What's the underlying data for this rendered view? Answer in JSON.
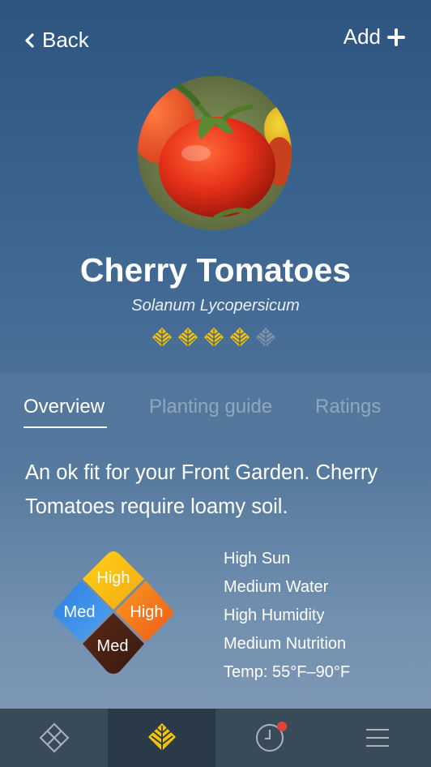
{
  "header": {
    "back_label": "Back",
    "add_label": "Add"
  },
  "plant": {
    "name": "Cherry Tomatoes",
    "scientific_name": "Solanum Lycopersicum",
    "rating": {
      "filled": 4,
      "total": 5
    }
  },
  "tabs": [
    {
      "label": "Overview",
      "active": true
    },
    {
      "label": "Planting guide",
      "active": false
    },
    {
      "label": "Ratings",
      "active": false
    }
  ],
  "overview": {
    "description": "An ok fit for your Front Garden. Cherry Tomatoes require loamy soil.",
    "diamond": {
      "top": "High",
      "left": "Med",
      "right": "High",
      "bottom": "Med"
    },
    "stats": [
      "High Sun",
      "Medium Water",
      "High Humidity",
      "Medium Nutrition",
      "Temp: 55°F–90°F"
    ]
  },
  "navbar": {
    "items": [
      {
        "icon": "garden-diamond-icon",
        "active": false
      },
      {
        "icon": "leaf-icon",
        "active": true
      },
      {
        "icon": "clock-icon",
        "active": false,
        "badge": true
      },
      {
        "icon": "menu-icon",
        "active": false
      }
    ]
  },
  "colors": {
    "accent_yellow": "#f4c20d",
    "sun_orange": "#f78f1e",
    "water_blue": "#3a8fe8",
    "soil_brown": "#4a2418",
    "navbar": "#394a59",
    "badge_red": "#e2443a"
  }
}
